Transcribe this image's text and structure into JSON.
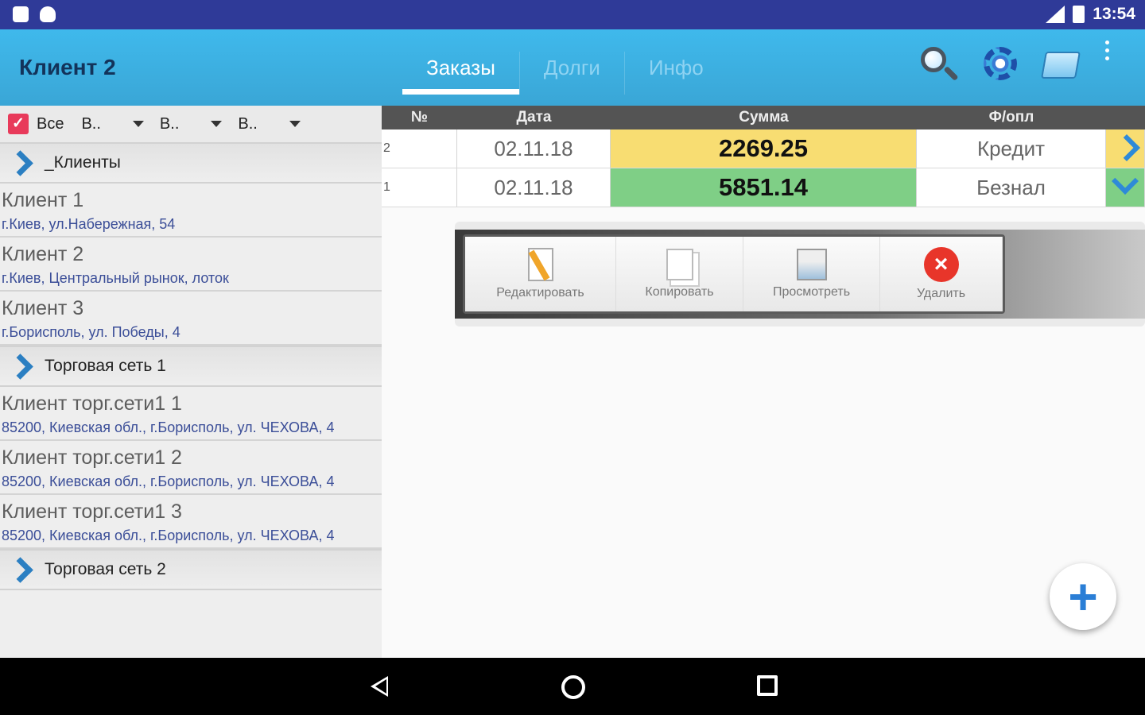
{
  "status_bar": {
    "time": "13:54"
  },
  "app_bar": {
    "title": "Клиент 2",
    "tabs": [
      {
        "label": "Заказы"
      },
      {
        "label": "Долги"
      },
      {
        "label": "Инфо"
      }
    ]
  },
  "filter_bar": {
    "all_label": "Все",
    "dropdowns": [
      {
        "label": "В.."
      },
      {
        "label": "В.."
      },
      {
        "label": "В.."
      }
    ]
  },
  "sidebar": {
    "groups": [
      {
        "label": "_Клиенты",
        "clients": [
          {
            "name": "Клиент 1",
            "address": "г.Киев, ул.Набережная, 54"
          },
          {
            "name": "Клиент 2",
            "address": "г.Киев, Центральный рынок, лоток"
          },
          {
            "name": "Клиент 3",
            "address": "г.Борисполь, ул. Победы, 4"
          }
        ]
      },
      {
        "label": "Торговая сеть 1",
        "clients": [
          {
            "name": "Клиент торг.сети1 1",
            "address": "85200, Киевская обл., г.Борисполь, ул. ЧЕХОВА, 4"
          },
          {
            "name": "Клиент торг.сети1 2",
            "address": "85200, Киевская обл., г.Борисполь, ул. ЧЕХОВА, 4"
          },
          {
            "name": "Клиент торг.сети1 3",
            "address": "85200, Киевская обл., г.Борисполь, ул. ЧЕХОВА, 4"
          }
        ]
      },
      {
        "label": "Торговая сеть 2",
        "clients": []
      }
    ]
  },
  "orders_table": {
    "headers": {
      "num": "№",
      "date": "Дата",
      "sum": "Сумма",
      "payment": "Ф/опл"
    },
    "rows": [
      {
        "num": "2",
        "date": "02.11.18",
        "sum": "2269.25",
        "payment": "Кредит",
        "sum_color": "#f8dd72"
      },
      {
        "num": "1",
        "date": "02.11.18",
        "sum": "5851.14",
        "payment": "Безнал",
        "sum_color": "#7fcf86"
      }
    ]
  },
  "context_menu": {
    "edit_label": "Редактировать",
    "copy_label": "Копировать",
    "view_label": "Просмотреть",
    "delete_label": "Удалить"
  },
  "fab": {
    "label": "+"
  }
}
